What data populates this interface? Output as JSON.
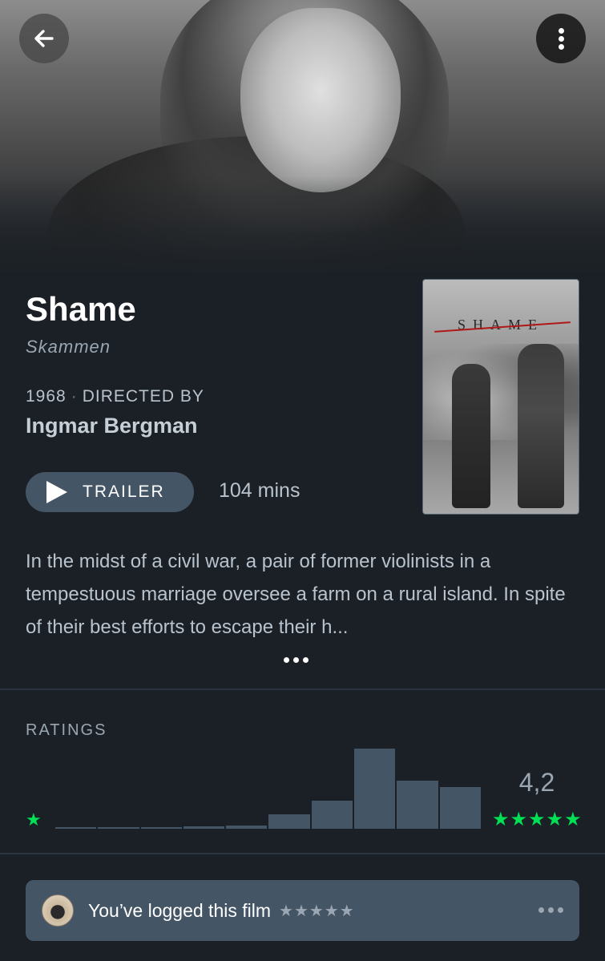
{
  "film": {
    "title": "Shame",
    "original_title": "Skammen",
    "year": "1968",
    "directed_by_label": "DIRECTED BY",
    "director": "Ingmar Bergman",
    "trailer_label": "TRAILER",
    "runtime": "104 mins",
    "synopsis": "In the midst of a civil war, a pair of former violinists in a tempestuous marriage oversee a farm on a rural island. In spite of their best efforts to escape their h...",
    "poster_title": "SHAME"
  },
  "ratings": {
    "label": "RATINGS",
    "min_star": "★",
    "average": "4,2",
    "max_stars": "★★★★★",
    "histogram": [
      0.01,
      0.01,
      0.01,
      0.03,
      0.04,
      0.18,
      0.35,
      1.0,
      0.6,
      0.52
    ]
  },
  "log": {
    "text": "You’ve logged this film",
    "stars": "★★★★★"
  },
  "icons": {
    "back": "back-arrow-icon",
    "more": "more-vertical-icon",
    "play": "play-icon",
    "ellipsis": "ellipsis-icon"
  },
  "colors": {
    "background": "#1b2026",
    "accent_green": "#00e054",
    "button": "#445566",
    "text_secondary": "#9aa6b2"
  }
}
